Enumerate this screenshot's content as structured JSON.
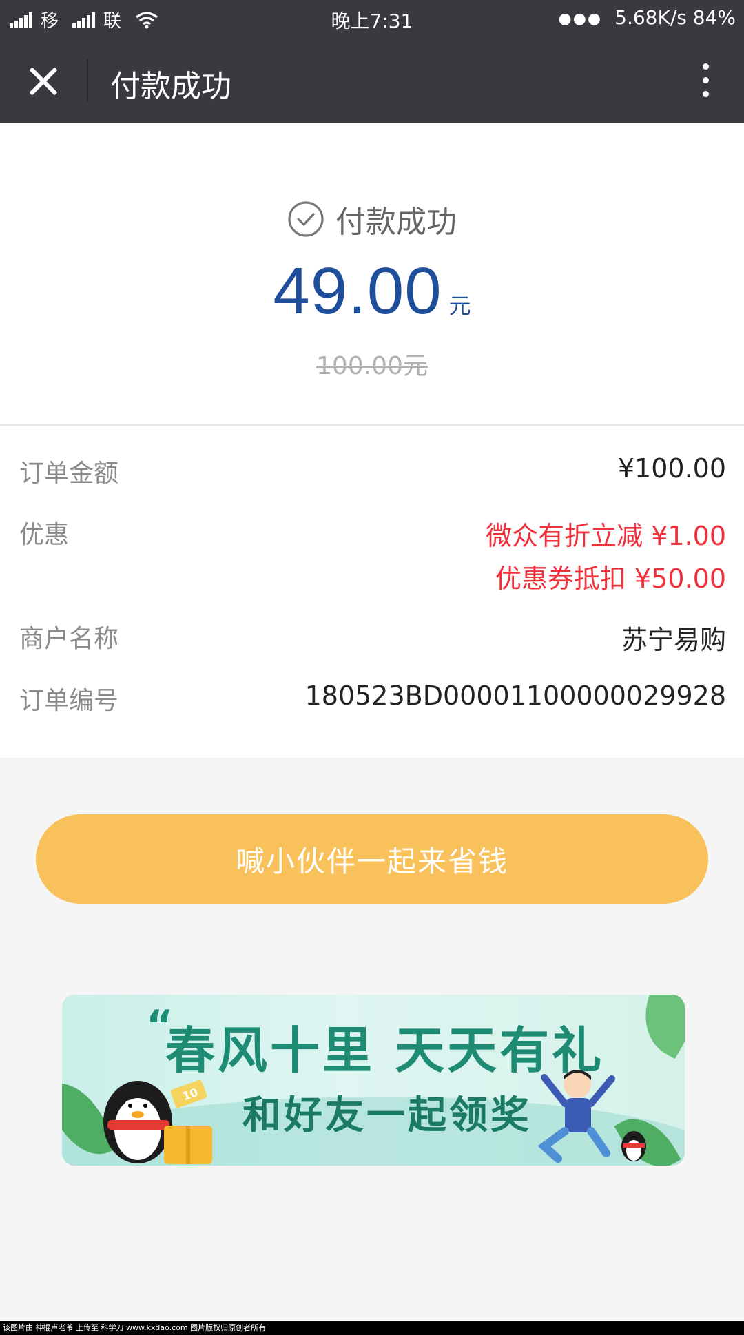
{
  "status_bar": {
    "carrier1": "移",
    "carrier2": "联",
    "time": "晚上7:31",
    "network_speed_battery": "5.68K/s 84%"
  },
  "nav": {
    "title": "付款成功",
    "close_icon": "close-icon",
    "more_icon": "more-vertical-icon"
  },
  "summary": {
    "status_text": "付款成功",
    "amount": "49.00",
    "amount_unit": "元",
    "original_price": "100.00元"
  },
  "details": {
    "order_amount_label": "订单金额",
    "order_amount_value": "¥100.00",
    "discount_label": "优惠",
    "discount_lines": [
      "微众有折立减 ¥1.00",
      "优惠券抵扣 ¥50.00"
    ],
    "merchant_label": "商户名称",
    "merchant_value": "苏宁易购",
    "order_no_label": "订单编号",
    "order_no_value": "180523BD00001100000029928"
  },
  "actions": {
    "share_label": "喊小伙伴一起来省钱"
  },
  "banner": {
    "line1": "春风十里 天天有礼",
    "line2": "和好友一起领奖",
    "coupon_badge": "10"
  },
  "footer": {
    "watermark": "该图片由 神棍卢老爷 上传至 科学刀 www.kxdao.com 图片版权归原创者所有"
  },
  "colors": {
    "nav_bg": "#393a3f",
    "amount_blue": "#1f4f9a",
    "discount_red": "#f0303a",
    "button_yellow": "#f9c15b"
  }
}
